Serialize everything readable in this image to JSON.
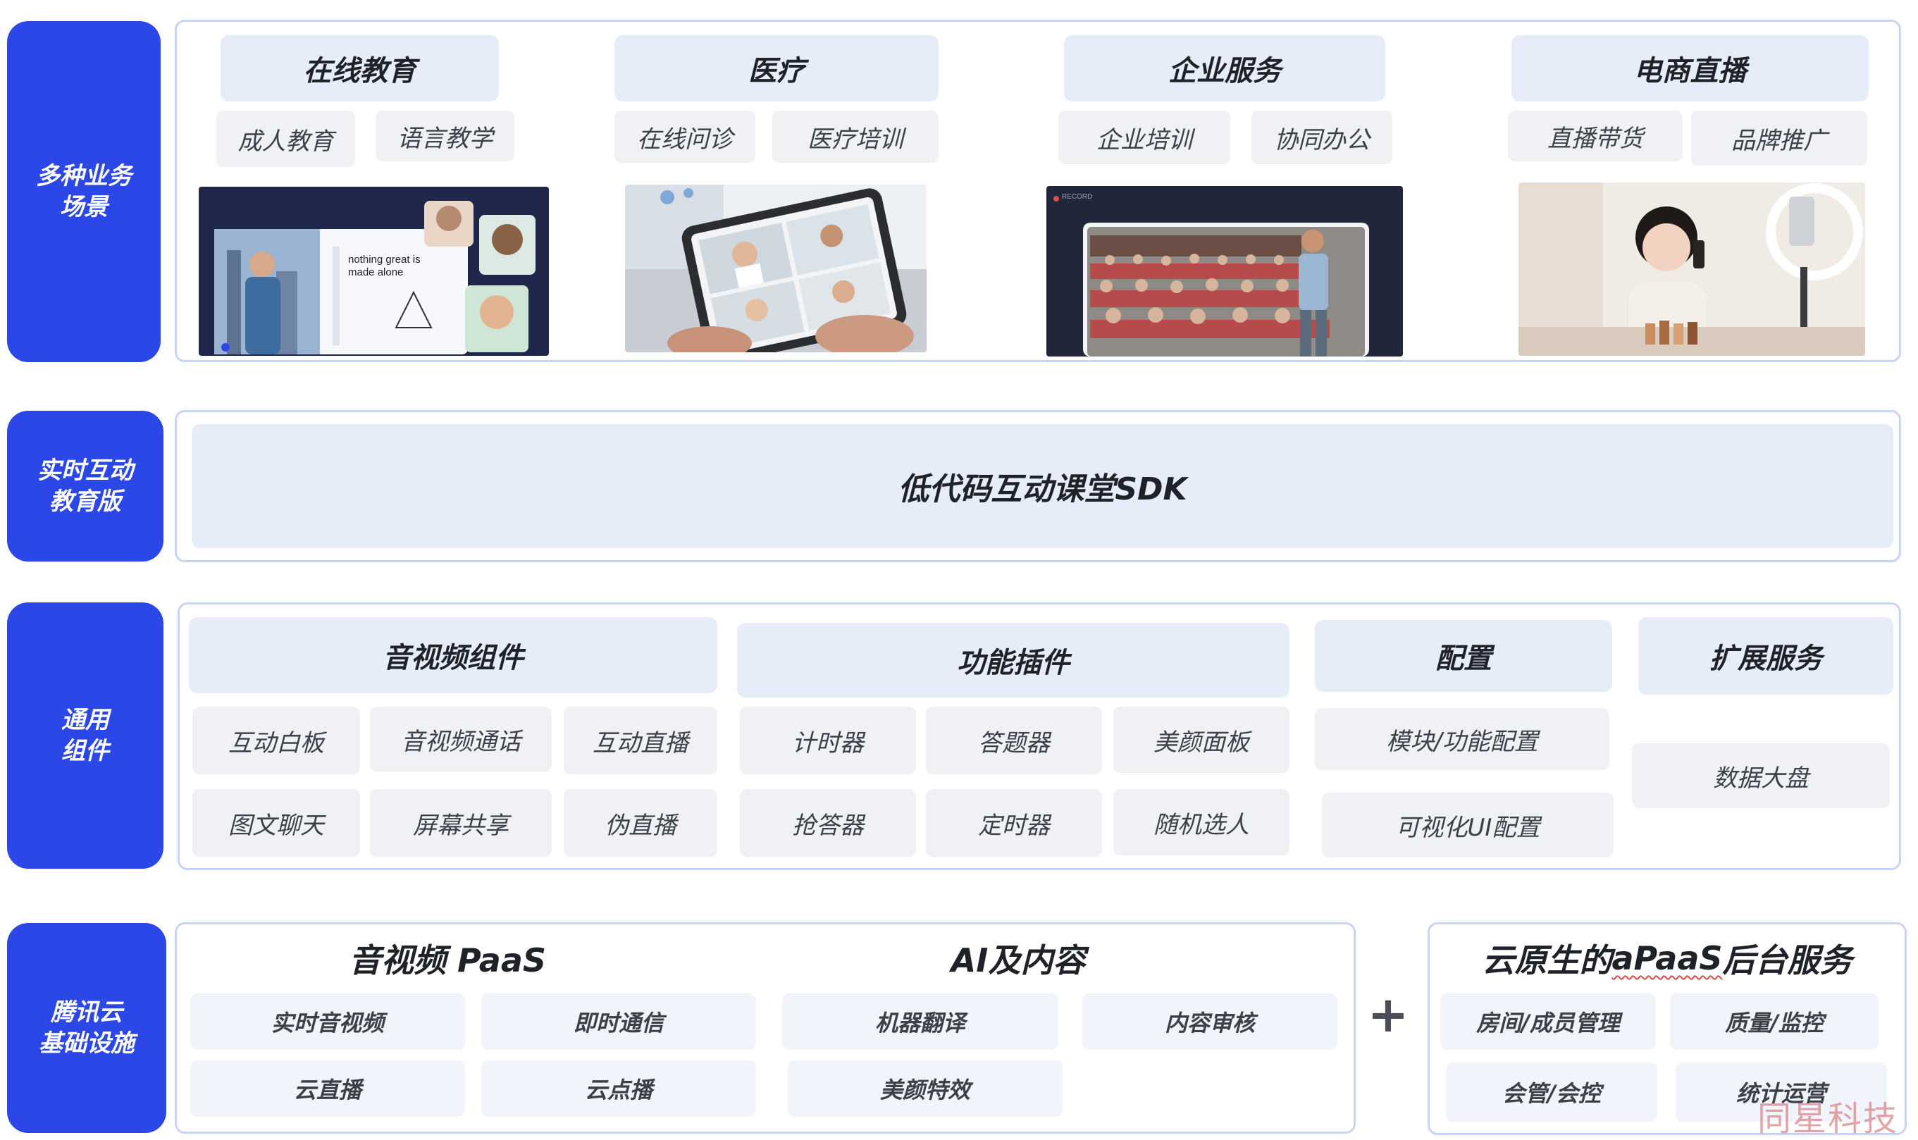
{
  "rows": {
    "scenarios": {
      "label": "多种业务\n场景"
    },
    "edition": {
      "label": "实时互动\n教育版"
    },
    "components": {
      "label": "通用\n组件"
    },
    "infra": {
      "label": "腾讯云\n基础设施"
    }
  },
  "scenarios": [
    {
      "title": "在线教育",
      "tags": [
        "成人教育",
        "语言教学"
      ],
      "image_icon": "online-class-screenshot",
      "image_text": "nothing great is made alone"
    },
    {
      "title": "医疗",
      "tags": [
        "在线问诊",
        "医疗培训"
      ],
      "image_icon": "tablet-video-consult"
    },
    {
      "title": "企业服务",
      "tags": [
        "企业培训",
        "协同办公"
      ],
      "image_icon": "auditorium-lecture",
      "image_text": "RECORD"
    },
    {
      "title": "电商直播",
      "tags": [
        "直播带货",
        "品牌推广"
      ],
      "image_icon": "livestream-host"
    }
  ],
  "edition": {
    "sdk_label": "低代码互动课堂SDK"
  },
  "components": {
    "av": {
      "title": "音视频组件",
      "items": [
        "互动白板",
        "音视频通话",
        "互动直播",
        "图文聊天",
        "屏幕共享",
        "伪直播"
      ]
    },
    "plugins": {
      "title": "功能插件",
      "items": [
        "计时器",
        "答题器",
        "美颜面板",
        "抢答器",
        "定时器",
        "随机选人"
      ]
    },
    "config": {
      "title": "配置",
      "items": [
        "模块/功能配置",
        "可视化UI配置"
      ]
    },
    "ext": {
      "title": "扩展服务",
      "items": [
        "数据大盘"
      ]
    }
  },
  "infra": {
    "paas": {
      "title": "音视频 PaaS",
      "items": [
        "实时音视频",
        "即时通信",
        "云直播",
        "云点播"
      ]
    },
    "ai": {
      "title": "AI及内容",
      "items": [
        "机器翻译",
        "内容审核",
        "美颜特效"
      ]
    },
    "plus": "+",
    "apaas": {
      "title_pre": "云原生的",
      "title_mark": "aPaaS",
      "title_post": "后台服务",
      "items": [
        "房间/成员管理",
        "质量/监控",
        "会管/会控",
        "统计运营"
      ]
    }
  },
  "watermark": "同星科技",
  "colors": {
    "accent": "#2b47e8",
    "frame": "#c9d3f5",
    "header": "#e6ecf8",
    "chip": "#eff1f5"
  }
}
